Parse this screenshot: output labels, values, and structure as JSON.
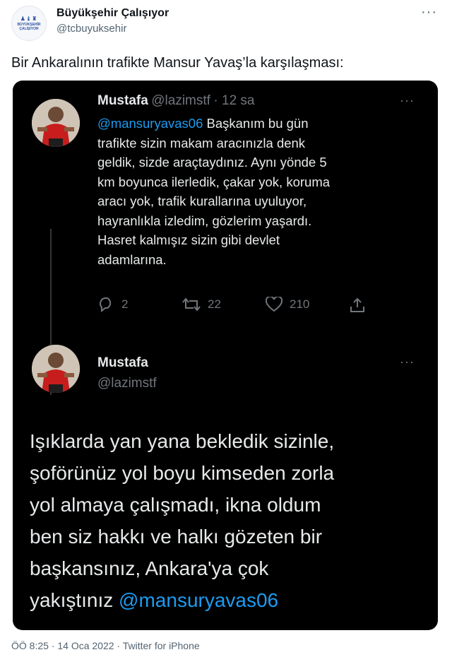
{
  "outer_tweet": {
    "author_name": "Büyükşehir Çalışıyor",
    "author_handle": "@tcbuyuksehir",
    "logo_text_line1": "BÜYÜKŞEHİR",
    "logo_text_line2": "ÇALIŞIYOR",
    "more_icon": "more-dots-icon",
    "text": "Bir Ankaralının trafikte Mansur Yavaş’la karşılaşması:",
    "footer": "ÖÖ 8:25 · 14 Oca 2022 · Twitter for iPhone"
  },
  "embedded_tweet": {
    "author_name": "Mustafa",
    "author_handle": "@lazimstf",
    "time": "· 12 sa",
    "mention": "@mansuryavas06",
    "lines": [
      " Başkanım bu gün",
      "trafikte sizin makam aracınızla denk",
      "geldik, sizde araçtaydınız. Aynı yönde 5",
      "km boyunca ilerledik, çakar yok, koruma",
      "aracı yok, trafik kurallarına uyuluyor,",
      "hayranlıkla izledim, gözlerim yaşardı.",
      "Hasret kalmışız sizin gibi devlet",
      "adamlarına."
    ],
    "reply_count": "2",
    "retweet_count": "22",
    "like_count": "210"
  },
  "reply_tweet": {
    "author_name": "Mustafa",
    "author_handle": "@lazimstf",
    "lines": [
      "Işıklarda yan yana bekledik sizinle,",
      "şoförünüz yol boyu kimseden zorla",
      "yol almaya çalışmadı, ikna oldum",
      "ben siz hakkı ve halkı gözeten bir",
      "başkansınız, Ankara'ya çok",
      "yakıştınız "
    ],
    "mention": "@mansuryavas06"
  },
  "colors": {
    "accent": "#1d9bf0",
    "dark_bg": "#000000",
    "muted": "#71767b"
  }
}
